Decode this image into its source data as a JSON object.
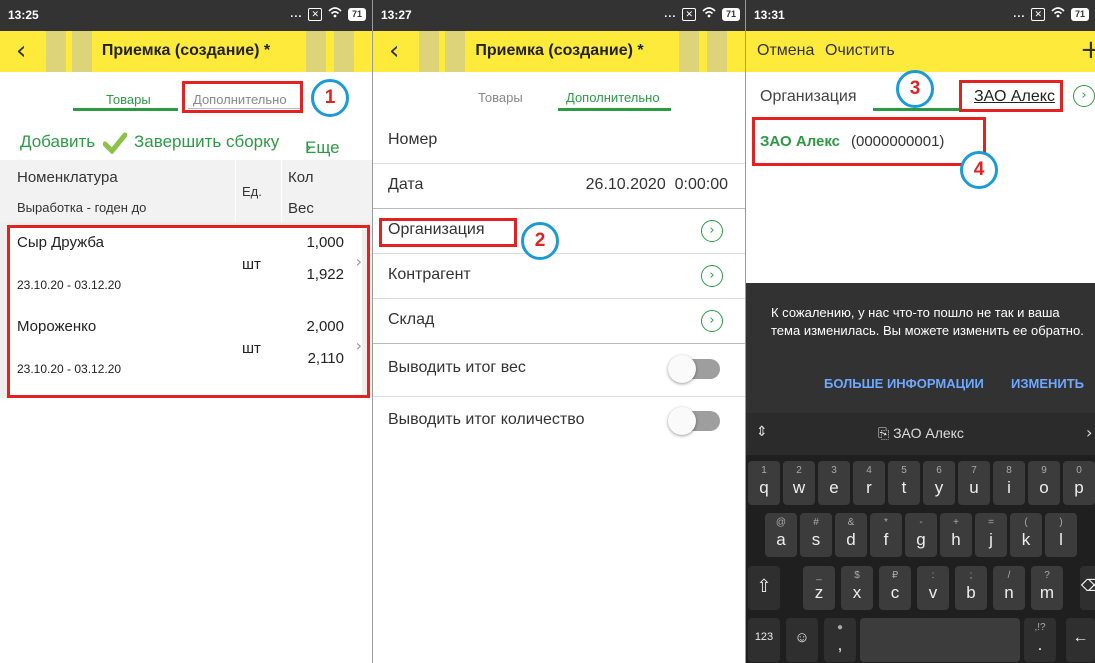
{
  "panel1": {
    "time": "13:25",
    "status_dots": "...",
    "battery": "71",
    "title": "Приемка (создание) *",
    "tabs": [
      "Товары",
      "Дополнительно"
    ],
    "toolbar": {
      "add": "Добавить",
      "finish": "Завершить сборку",
      "more": "Еще"
    },
    "columns": {
      "nomenclature": "Номенклатура",
      "output": "Выработка - годен до",
      "unit": "Ед.",
      "qty": "Кол",
      "weight": "Вес"
    },
    "rows": [
      {
        "name": "Сыр Дружба",
        "unit": "шт",
        "qty": "1,000",
        "weight": "1,922",
        "dates": "23.10.20 - 03.12.20"
      },
      {
        "name": "Мороженко",
        "unit": "шт",
        "qty": "2,000",
        "weight": "2,110",
        "dates": "23.10.20 - 03.12.20"
      }
    ],
    "badge": "1"
  },
  "panel2": {
    "time": "13:27",
    "status_dots": "...",
    "battery": "71",
    "title": "Приемка (создание) *",
    "tabs": [
      "Товары",
      "Дополнительно"
    ],
    "fields": {
      "number": "Номер",
      "date": "Дата",
      "date_value": "26.10.2020  0:00:00",
      "organization": "Организация",
      "counterparty": "Контрагент",
      "warehouse": "Склад",
      "show_weight": "Выводить итог вес",
      "show_qty": "Выводить итог количество"
    },
    "badge": "2"
  },
  "panel3": {
    "time": "13:31",
    "status_dots": "...",
    "battery": "71",
    "cancel": "Отмена",
    "clear": "Очистить",
    "plus": "+",
    "field_label": "Организация",
    "field_value": "ЗАО Алекс",
    "result_name": "ЗАО Алекс",
    "result_code": "(0000000001)",
    "snackbar": {
      "message": "К сожалению, у нас что-то пошло не так и ваша тема изменилась. Вы можете изменить ее обратно.",
      "more_info": "БОЛЬШЕ ИНФОРМАЦИИ",
      "change": "ИЗМЕНИТЬ"
    },
    "keyboard": {
      "suggestion": "ЗАО Алекс",
      "row1": [
        {
          "h": "1",
          "m": "q"
        },
        {
          "h": "2",
          "m": "w"
        },
        {
          "h": "3",
          "m": "e"
        },
        {
          "h": "4",
          "m": "r"
        },
        {
          "h": "5",
          "m": "t"
        },
        {
          "h": "6",
          "m": "y"
        },
        {
          "h": "7",
          "m": "u"
        },
        {
          "h": "8",
          "m": "i"
        },
        {
          "h": "9",
          "m": "o"
        },
        {
          "h": "0",
          "m": "p"
        }
      ],
      "row2": [
        {
          "h": "@",
          "m": "a"
        },
        {
          "h": "#",
          "m": "s"
        },
        {
          "h": "&",
          "m": "d"
        },
        {
          "h": "*",
          "m": "f"
        },
        {
          "h": "-",
          "m": "g"
        },
        {
          "h": "+",
          "m": "h"
        },
        {
          "h": "=",
          "m": "j"
        },
        {
          "h": "(",
          "m": "k"
        },
        {
          "h": ")",
          "m": "l"
        }
      ],
      "row3": [
        {
          "h": "_",
          "m": "z"
        },
        {
          "h": "$",
          "m": "x"
        },
        {
          "h": "₽",
          "m": "c"
        },
        {
          "h": ":",
          "m": "v"
        },
        {
          "h": ";",
          "m": "b"
        },
        {
          "h": "/",
          "m": "n"
        },
        {
          "h": "?",
          "m": "m"
        }
      ],
      "num_key": "123",
      "comma": ",",
      "period": ".",
      "period_hint": ",!?"
    },
    "badges": [
      "3",
      "4"
    ]
  },
  "colors": {
    "appbar": "#fdea3b",
    "accent_green": "#2c9a43",
    "annotation_red": "#e32121",
    "annotation_blue": "#1a9ad6"
  }
}
